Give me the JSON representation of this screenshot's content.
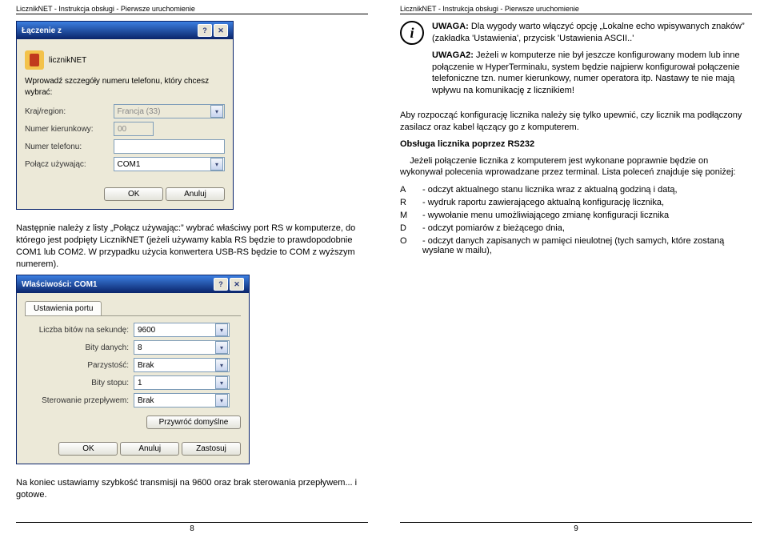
{
  "left": {
    "header": "LicznikNET - Instrukcja obsługi - Pierwsze uruchomienie",
    "connDialog": {
      "title": "Łączenie z",
      "appLabel": "licznikNET",
      "prompt": "Wprowadź szczegóły numeru telefonu, który chcesz wybrać:",
      "countryLabel": "Kraj/region:",
      "countryValue": "Francja (33)",
      "areaLabel": "Numer kierunkowy:",
      "areaValue": "00",
      "phoneLabel": "Numer telefonu:",
      "phoneValue": "",
      "connectLabel": "Połącz używając:",
      "connectValue": "COM1",
      "ok": "OK",
      "cancel": "Anuluj"
    },
    "para1": "Następnie należy z listy „Połącz używając:” wybrać właściwy port RS w komputerze, do którego jest podpięty LicznikNET (jeżeli używamy kabla RS będzie to prawdopodobnie COM1 lub COM2. W przypadku użycia konwertera USB-RS będzie to COM z wyższym numerem).",
    "propDialog": {
      "title": "Właściwości: COM1",
      "tab": "Ustawienia portu",
      "baudLabel": "Liczba bitów na sekundę:",
      "baudValue": "9600",
      "dataLabel": "Bity danych:",
      "dataValue": "8",
      "parityLabel": "Parzystość:",
      "parityValue": "Brak",
      "stopLabel": "Bity stopu:",
      "stopValue": "1",
      "flowLabel": "Sterowanie przepływem:",
      "flowValue": "Brak",
      "defaults": "Przywróć domyślne",
      "ok": "OK",
      "cancel": "Anuluj",
      "apply": "Zastosuj"
    },
    "para2": "Na koniec ustawiamy szybkość transmisji na 9600 oraz brak sterowania przepływem... i gotowe.",
    "pagenum": "8"
  },
  "right": {
    "header": "LicznikNET - Instrukcja obsługi - Pierwsze uruchomienie",
    "note1a": "UWAGA:",
    "note1b": " Dla wygody warto włączyć opcję „Lokalne echo wpisywanych znaków” (zakładka 'Ustawienia', przycisk 'Ustawienia ASCII..'",
    "note2a": "UWAGA2:",
    "note2b": " Jeżeli w komputerze nie był jeszcze konfigurowany modem lub inne połączenie w HyperTerminalu, system będzie najpierw konfigurował połączenie telefoniczne tzn. numer kierunkowy, numer operatora itp. Nastawy te nie mają wpływu na komunikację z licznikiem!",
    "para1": "Aby rozpocząć konfigurację licznika należy się tylko upewnić, czy licznik ma podłączony zasilacz oraz kabel łączący go z komputerem.",
    "heading": "Obsługa licznika poprzez RS232",
    "para2": "    Jeżeli połączenie licznika z komputerem jest wykonane poprawnie będzie on wykonywał polecenia wprowadzane przez terminal. Lista poleceń znajduje się poniżej:",
    "cmds": {
      "A": "- odczyt aktualnego stanu licznika wraz z aktualną godziną i datą,",
      "R": "- wydruk raportu zawierającego aktualną konfigurację licznika,",
      "M": "- wywołanie menu umożliwiającego zmianę konfiguracji licznika",
      "D": "- odczyt pomiarów z bieżącego dnia,",
      "O": "- odczyt danych zapisanych w pamięci nieulotnej (tych samych, które zostaną wysłane w mailu),"
    },
    "pagenum": "9"
  }
}
